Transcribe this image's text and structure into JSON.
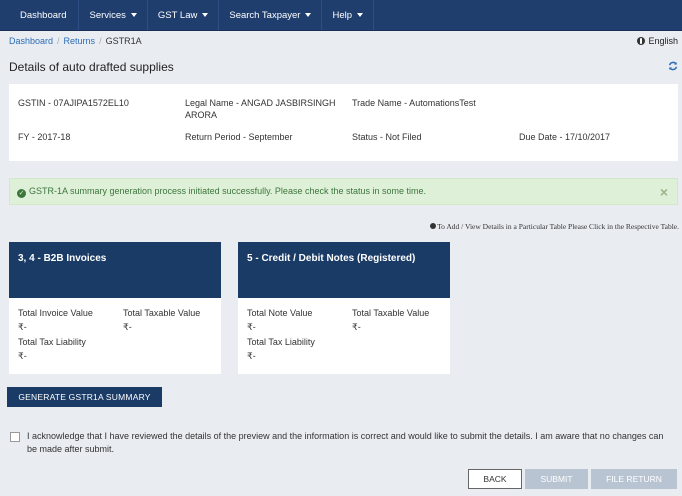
{
  "nav": {
    "items": [
      {
        "label": "Dashboard",
        "caret": false
      },
      {
        "label": "Services",
        "caret": true
      },
      {
        "label": "GST Law",
        "caret": true
      },
      {
        "label": "Search Taxpayer",
        "caret": true
      },
      {
        "label": "Help",
        "caret": true
      }
    ]
  },
  "breadcrumb": {
    "items": [
      "Dashboard",
      "Returns",
      "GSTR1A"
    ],
    "separator": "/"
  },
  "language": "English",
  "page_title": "Details of auto drafted supplies",
  "info": {
    "gstin": "GSTIN - 07AJIPA1572EL10",
    "legal_name_1": "Legal Name - ANGAD JASBIRSINGH",
    "legal_name_2": "ARORA",
    "trade_name": "Trade Name - AutomationsTest",
    "fy": "FY - 2017-18",
    "return_period": "Return Period - September",
    "status": "Status - Not Filed",
    "due_date": "Due Date - 17/10/2017"
  },
  "alert": {
    "message": "GSTR-1A summary generation process initiated successfully. Please check the status in some time.",
    "close": "×"
  },
  "hint": "To Add / View Details in a Particular Table Please Click in the Respective Table.",
  "tiles": [
    {
      "title": "3, 4 - B2B Invoices",
      "f1": "Total Invoice Value",
      "v1": "₹-",
      "f2": "Total Taxable Value",
      "v2": "₹-",
      "f3": "Total Tax Liability",
      "v3": "₹-"
    },
    {
      "title": "5 - Credit / Debit Notes (Registered)",
      "f1": "Total Note Value",
      "v1": "₹-",
      "f2": "Total Taxable Value",
      "v2": "₹-",
      "f3": "Total Tax Liability",
      "v3": "₹-"
    }
  ],
  "generate_button": "GENERATE GSTR1A SUMMARY",
  "acknowledge": "I acknowledge that I have reviewed the details of the preview and the information is correct and would like to submit the details. I am aware that no changes can be made after submit.",
  "buttons": {
    "back": "BACK",
    "submit": "SUBMIT",
    "file_return": "FILE RETURN"
  },
  "colors": {
    "nav_bg": "#1f3e6e",
    "tile_header": "#1a3b66",
    "alert_bg": "#dff0d8",
    "alert_text": "#3c763d",
    "disabled_button": "#b9c4d3"
  }
}
